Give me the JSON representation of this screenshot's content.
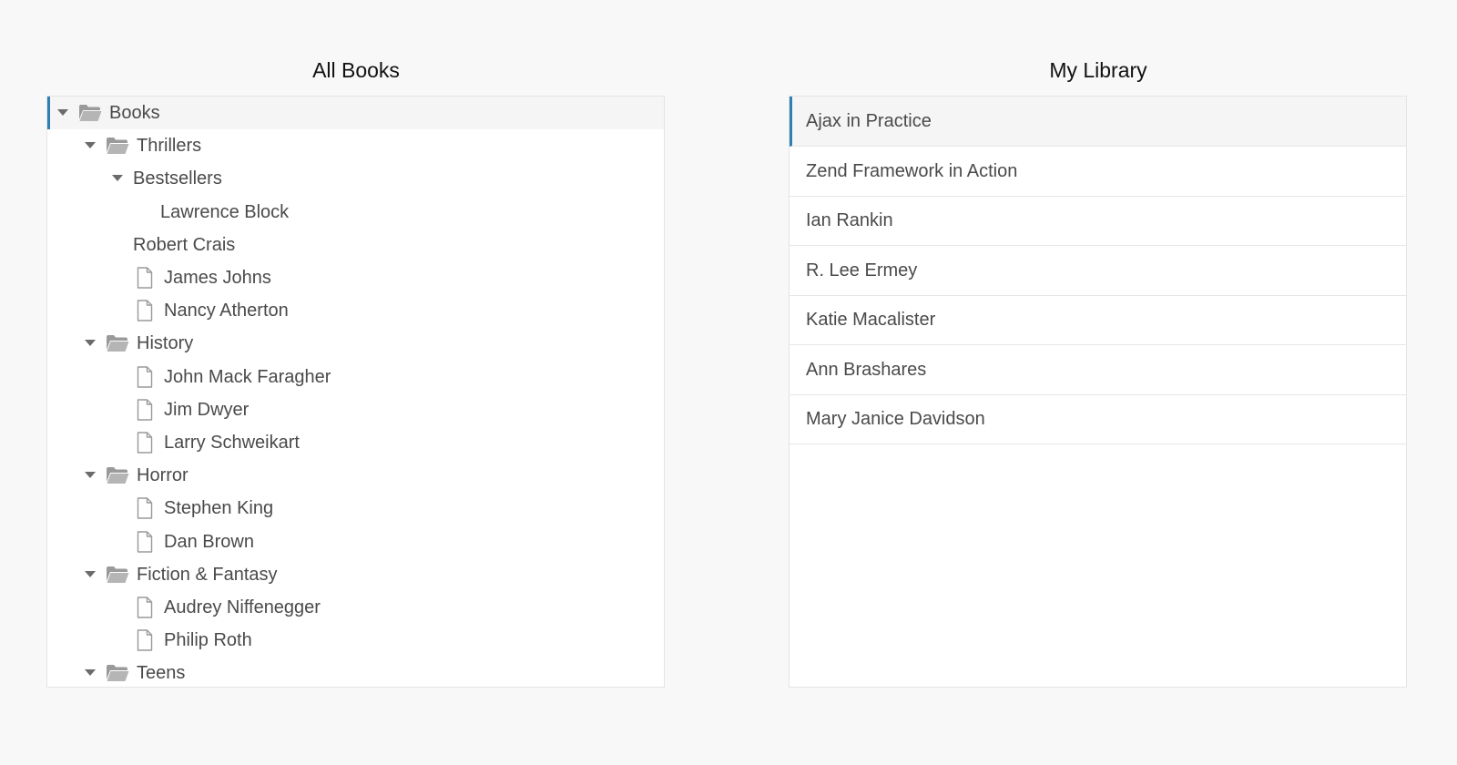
{
  "colors": {
    "page_background": "#f8f8f8",
    "panel_background": "#ffffff",
    "accent": "#2f7fb0",
    "text": "#4a4a4a",
    "icon": "#9a9a9a"
  },
  "all_books": {
    "title": "All Books",
    "tree": [
      {
        "label": "Books",
        "depth": 0,
        "icon": "folder-open-icon",
        "expanded": true,
        "selected": true
      },
      {
        "label": "Thrillers",
        "depth": 1,
        "icon": "folder-open-icon",
        "expanded": true
      },
      {
        "label": "Bestsellers",
        "depth": 2,
        "icon": "",
        "expanded": true
      },
      {
        "label": "Lawrence Block",
        "depth": 3,
        "icon": ""
      },
      {
        "label": "Robert Crais",
        "depth": 2,
        "icon": ""
      },
      {
        "label": "James Johns",
        "depth": 2,
        "icon": "file-icon"
      },
      {
        "label": "Nancy Atherton",
        "depth": 2,
        "icon": "file-icon"
      },
      {
        "label": "History",
        "depth": 1,
        "icon": "folder-open-icon",
        "expanded": true
      },
      {
        "label": "John Mack Faragher",
        "depth": 2,
        "icon": "file-icon"
      },
      {
        "label": "Jim Dwyer",
        "depth": 2,
        "icon": "file-icon"
      },
      {
        "label": "Larry Schweikart",
        "depth": 2,
        "icon": "file-icon"
      },
      {
        "label": "Horror",
        "depth": 1,
        "icon": "folder-open-icon",
        "expanded": true
      },
      {
        "label": "Stephen King",
        "depth": 2,
        "icon": "file-icon"
      },
      {
        "label": "Dan Brown",
        "depth": 2,
        "icon": "file-icon"
      },
      {
        "label": "Fiction & Fantasy",
        "depth": 1,
        "icon": "folder-open-icon",
        "expanded": true
      },
      {
        "label": "Audrey Niffenegger",
        "depth": 2,
        "icon": "file-icon"
      },
      {
        "label": "Philip Roth",
        "depth": 2,
        "icon": "file-icon"
      },
      {
        "label": "Teens",
        "depth": 1,
        "icon": "folder-open-icon",
        "expanded": true
      }
    ]
  },
  "my_library": {
    "title": "My Library",
    "items": [
      {
        "label": "Ajax in Practice",
        "selected": true
      },
      {
        "label": "Zend Framework in Action"
      },
      {
        "label": "Ian Rankin"
      },
      {
        "label": "R. Lee Ermey"
      },
      {
        "label": "Katie Macalister"
      },
      {
        "label": "Ann Brashares"
      },
      {
        "label": "Mary Janice Davidson"
      }
    ]
  }
}
